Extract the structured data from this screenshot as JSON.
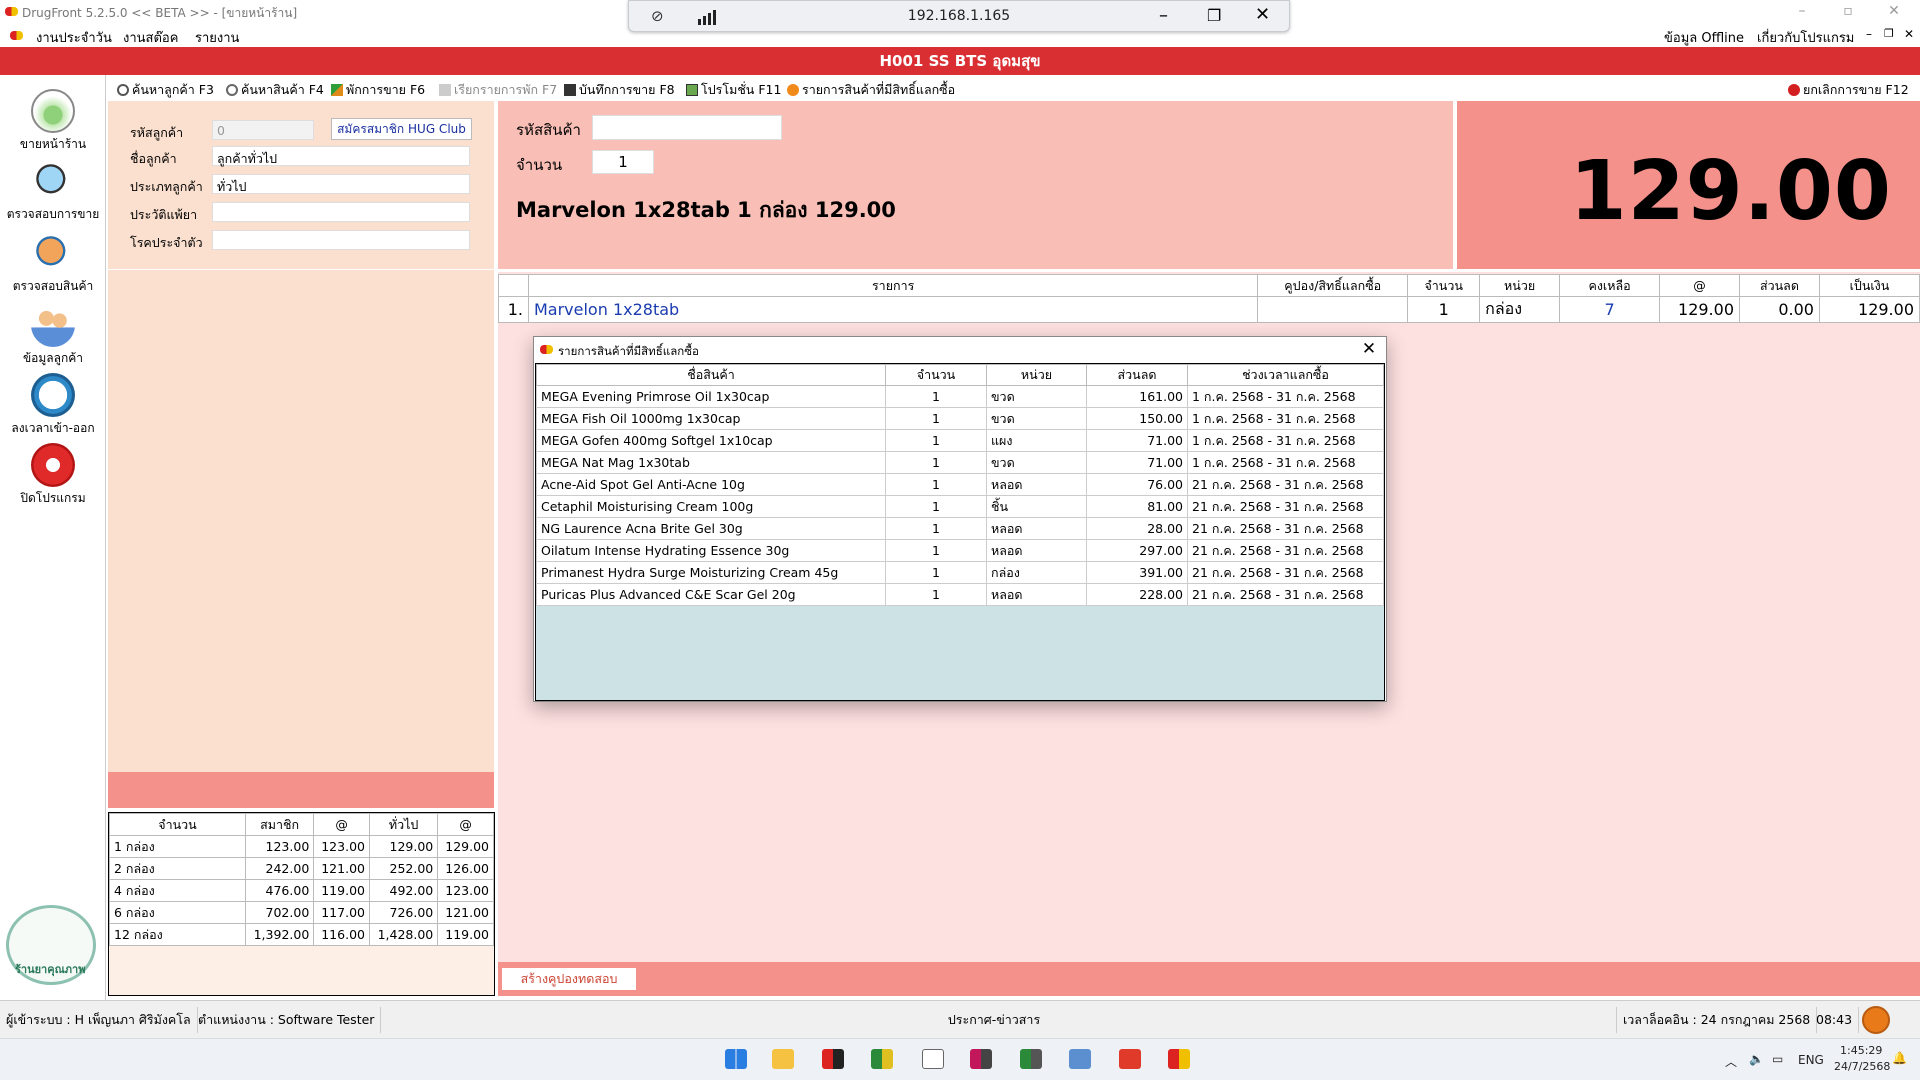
{
  "window": {
    "title": "DrugFront 5.2.5.0 << BETA >> - [ขายหน้าร้าน]",
    "menu": [
      "งานประจำวัน",
      "งานสต๊อค",
      "รายงาน"
    ],
    "menu_right": [
      "ข้อมูล Offline",
      "เกี่ยวกับโปรแกรม"
    ],
    "controls": [
      "–",
      "▫",
      "✕"
    ]
  },
  "remote_bar": {
    "ip": "192.168.1.165"
  },
  "store": {
    "name": "H001 SS BTS อุดมสุข"
  },
  "sidebar": {
    "items": [
      {
        "label": "ขายหน้าร้าน",
        "icon": "basket-icon"
      },
      {
        "label": "ตรวจสอบการขาย",
        "icon": "sales-check-icon"
      },
      {
        "label": "ตรวจสอบสินค้า",
        "icon": "product-check-icon"
      },
      {
        "label": "ข้อมูลลูกค้า",
        "icon": "customers-icon"
      },
      {
        "label": "ลงเวลาเข้า-ออก",
        "icon": "clock-icon"
      },
      {
        "label": "ปิดโปรแกรม",
        "icon": "power-icon"
      }
    ],
    "logo_text": "ร้านยาคุณภาพ"
  },
  "toolbar": {
    "items": [
      "ค้นหาลูกค้า F3",
      "ค้นหาสินค้า F4",
      "พักการขาย F6",
      "เรียกรายการพัก F7",
      "บันทึกการขาย F8",
      "โปรโมชั่น F11",
      "รายการสินค้าที่มีสิทธิ์แลกซื้อ"
    ],
    "cancel": "ยกเลิกการขาย F12"
  },
  "customer": {
    "code_label": "รหัสลูกค้า",
    "code_value": "0",
    "register_button": "สมัครสมาชิก HUG Club",
    "name_label": "ชื่อลูกค้า",
    "name_value": "ลูกค้าทั่วไป",
    "type_label": "ประเภทลูกค้า",
    "type_value": "ทั่วไป",
    "allergy_label": "ประวัติแพ้ยา",
    "allergy_value": "",
    "disease_label": "โรคประจำตัว",
    "disease_value": ""
  },
  "price_table": {
    "headers": [
      "จำนวน",
      "สมาชิก",
      "@",
      "ทั่วไป",
      "@"
    ],
    "rows": [
      [
        "1 กล่อง",
        "123.00",
        "123.00",
        "129.00",
        "129.00"
      ],
      [
        "2 กล่อง",
        "242.00",
        "121.00",
        "252.00",
        "126.00"
      ],
      [
        "4 กล่อง",
        "476.00",
        "119.00",
        "492.00",
        "123.00"
      ],
      [
        "6 กล่อง",
        "702.00",
        "117.00",
        "726.00",
        "121.00"
      ],
      [
        "12 กล่อง",
        "1,392.00",
        "116.00",
        "1,428.00",
        "119.00"
      ]
    ]
  },
  "entry": {
    "code_label": "รหัสสินค้า",
    "code_value": "",
    "qty_label": "จำนวน",
    "qty_value": "1",
    "product_line": "Marvelon 1x28tab  1  กล่อง 129.00"
  },
  "total": {
    "amount": "129.00"
  },
  "sale_table": {
    "headers": [
      "",
      "รายการ",
      "คูปอง/สิทธิ์แลกซื้อ",
      "จำนวน",
      "หน่วย",
      "คงเหลือ",
      "@",
      "ส่วนลด",
      "เป็นเงิน"
    ],
    "rows": [
      [
        "1.",
        "Marvelon 1x28tab",
        "",
        "1",
        "กล่อง",
        "7",
        "129.00",
        "0.00",
        "129.00"
      ]
    ]
  },
  "dialog": {
    "title": "รายการสินค้าที่มีสิทธิ์แลกซื้อ",
    "headers": [
      "ชื่อสินค้า",
      "จำนวน",
      "หน่วย",
      "ส่วนลด",
      "ช่วงเวลาแลกซื้อ"
    ],
    "rows": [
      [
        "MEGA Evening Primrose Oil 1x30cap",
        "1",
        "ขวด",
        "161.00",
        "1  ก.ค.  2568 - 31  ก.ค.  2568"
      ],
      [
        "MEGA Fish Oil 1000mg 1x30cap",
        "1",
        "ขวด",
        "150.00",
        "1  ก.ค.  2568 - 31  ก.ค.  2568"
      ],
      [
        "MEGA Gofen 400mg Softgel 1x10cap",
        "1",
        "แผง",
        "71.00",
        "1  ก.ค.  2568 - 31  ก.ค.  2568"
      ],
      [
        "MEGA Nat Mag 1x30tab",
        "1",
        "ขวด",
        "71.00",
        "1  ก.ค.  2568 - 31  ก.ค.  2568"
      ],
      [
        "Acne-Aid Spot Gel Anti-Acne 10g",
        "1",
        "หลอด",
        "76.00",
        "21  ก.ค.  2568 - 31  ก.ค.  2568"
      ],
      [
        "Cetaphil Moisturising Cream 100g",
        "1",
        "ชิ้น",
        "81.00",
        "21  ก.ค.  2568 - 31  ก.ค.  2568"
      ],
      [
        "NG Laurence Acna Brite Gel 30g",
        "1",
        "หลอด",
        "28.00",
        "21  ก.ค.  2568 - 31  ก.ค.  2568"
      ],
      [
        "Oilatum Intense Hydrating Essence 30g",
        "1",
        "หลอด",
        "297.00",
        "21  ก.ค.  2568 - 31  ก.ค.  2568"
      ],
      [
        "Primanest Hydra Surge Moisturizing Cream 45g",
        "1",
        "กล่อง",
        "391.00",
        "21  ก.ค.  2568 - 31  ก.ค.  2568"
      ],
      [
        "Puricas Plus Advanced C&E Scar Gel 20g",
        "1",
        "หลอด",
        "228.00",
        "21  ก.ค.  2568 - 31  ก.ค.  2568"
      ]
    ]
  },
  "bottom": {
    "coupon_button": "สร้างคูปองทดสอบ"
  },
  "status": {
    "user": "ผู้เข้าระบบ : H เพ็ญนภา ศิริมังคโล",
    "position": "ตำแหน่งงาน : Software Tester",
    "news": "ประกาศ-ข่าวสาร",
    "login_time": "เวลาล็อคอิน : 24  กรกฎาคม  2568",
    "clock": "08:43"
  },
  "taskbar": {
    "lang": "ENG",
    "time": "1:45:29",
    "date": "24/7/2568"
  },
  "colors": {
    "header_red": "#d92f32",
    "salmon": "#f4918a",
    "peach": "#fbe0cf",
    "pink_light": "#fde0e0"
  }
}
